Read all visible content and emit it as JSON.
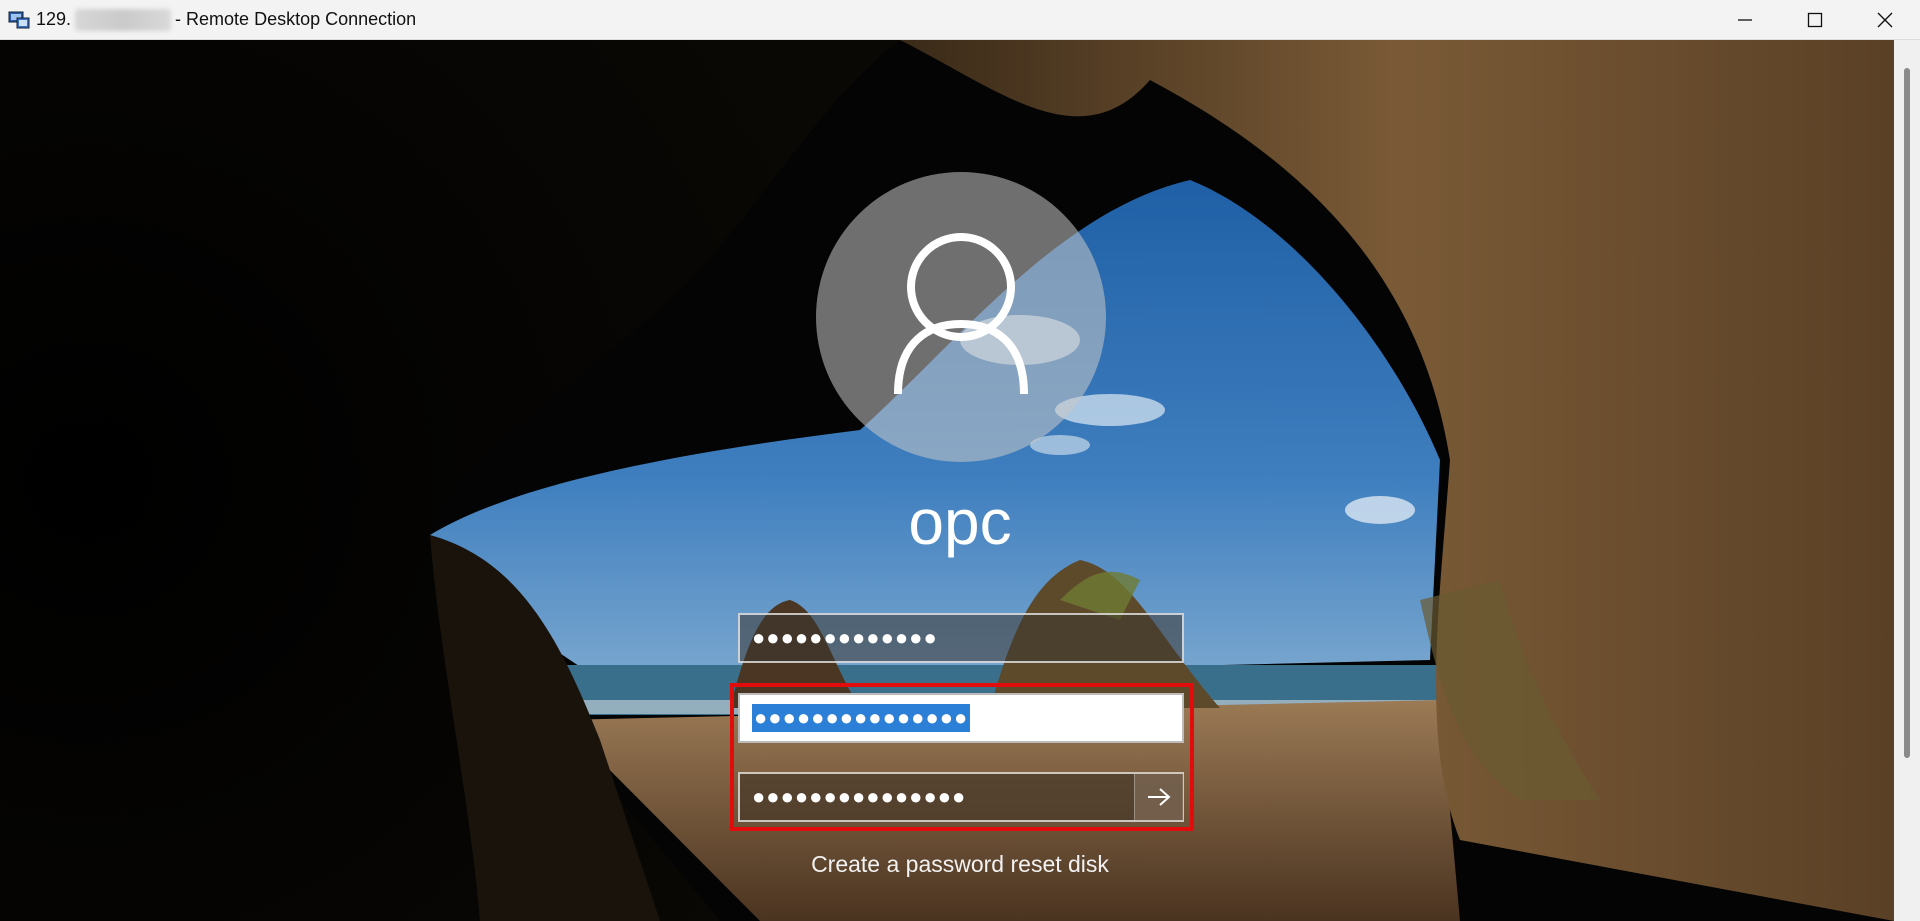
{
  "window": {
    "title_prefix": "129.",
    "title": "- Remote Desktop Connection",
    "icon": "remote-desktop-icon"
  },
  "login": {
    "username": "opc",
    "field_1": "●●●●●●●●●●●●●",
    "field_2_selected": "●●●●●●●●●●●●●●●",
    "field_3": "●●●●●●●●●●●●●●●",
    "submit_icon": "arrow-right-icon",
    "reset_link": "Create a password reset disk"
  },
  "colors": {
    "highlight": "#e10d0d",
    "selection": "#2c7fd6"
  }
}
